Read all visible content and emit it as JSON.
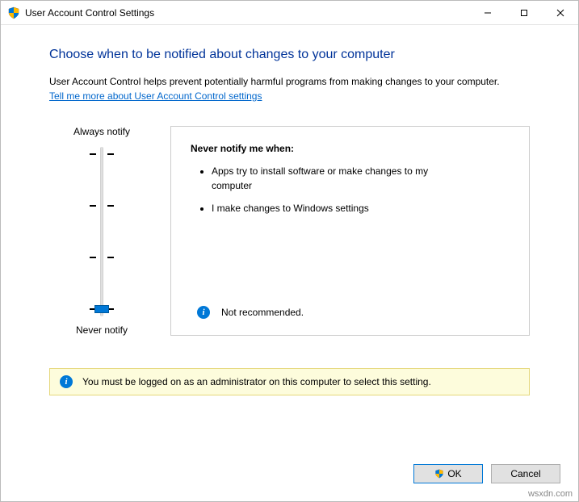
{
  "window": {
    "title": "User Account Control Settings"
  },
  "main": {
    "heading": "Choose when to be notified about changes to your computer",
    "description": "User Account Control helps prevent potentially harmful programs from making changes to your computer.",
    "help_link": "Tell me more about User Account Control settings"
  },
  "slider": {
    "top_label": "Always notify",
    "bottom_label": "Never notify",
    "position": 3,
    "levels": 4
  },
  "info": {
    "title": "Never notify me when:",
    "bullets": [
      "Apps try to install software or make changes to my computer",
      "I make changes to Windows settings"
    ],
    "recommendation": "Not recommended."
  },
  "admin_banner": "You must be logged on as an administrator on this computer to select this setting.",
  "buttons": {
    "ok": "OK",
    "cancel": "Cancel"
  },
  "watermark": "wsxdn.com"
}
